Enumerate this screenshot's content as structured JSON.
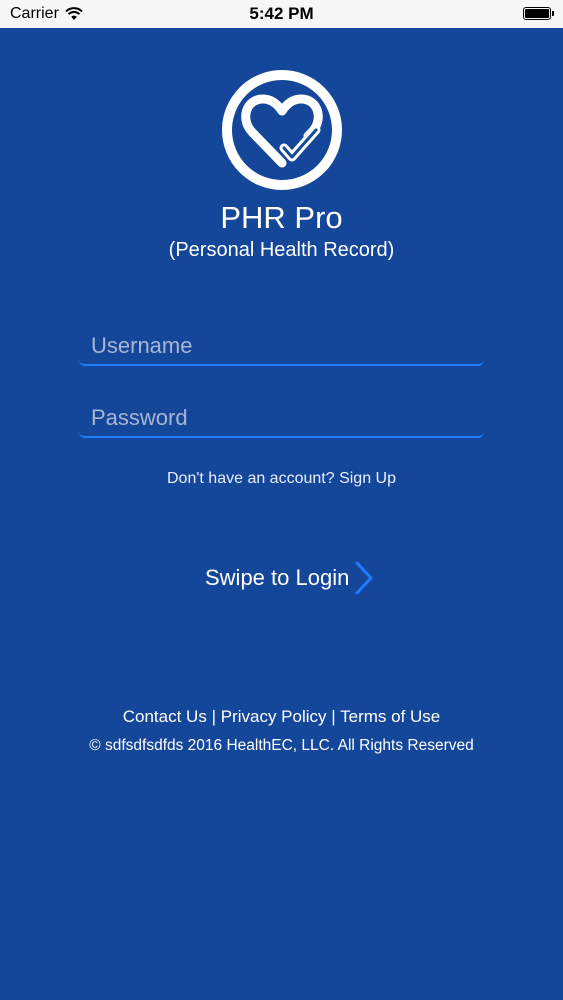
{
  "status_bar": {
    "carrier": "Carrier",
    "time": "5:42 PM"
  },
  "app": {
    "title": "PHR Pro",
    "subtitle": "(Personal Health Record)"
  },
  "login": {
    "username_placeholder": "Username",
    "password_placeholder": "Password",
    "signup_prompt": "Don't have an account?",
    "signup_link": "Sign Up",
    "swipe_label": "Swipe to Login"
  },
  "footer": {
    "contact": "Contact Us",
    "privacy": "Privacy Policy",
    "terms": "Terms of Use",
    "separator": "|",
    "copyright": "© sdfsdfsdfds 2016 HealthEC, LLC. All Rights Reserved"
  },
  "colors": {
    "background": "#14469a",
    "accent": "#1f7bff",
    "status_bar": "#f7f7f7"
  }
}
